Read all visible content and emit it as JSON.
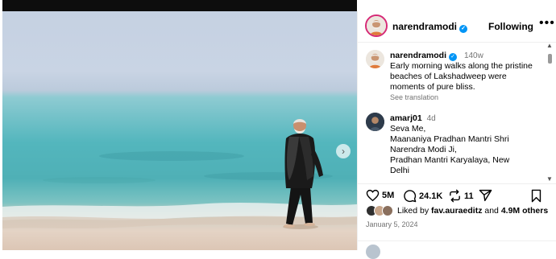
{
  "post": {
    "username": "narendramodi",
    "follow_state": "Following",
    "more_label": "•••",
    "caption": {
      "username": "narendramodi",
      "age": "140w",
      "lines": [
        "Early morning walks along the pristine",
        "beaches of Lakshadweep were",
        "moments of pure bliss."
      ],
      "see_translation": "See translation"
    },
    "comments": [
      {
        "username": "amarj01",
        "age": "4d",
        "lines": [
          "Seva Me,",
          "Maananiya Pradhan Mantri Shri",
          "Narendra Modi Ji,",
          "Pradhan Mantri Karyalaya, New",
          "Delhi"
        ]
      }
    ],
    "actions": {
      "likes_count": "5M",
      "comments_count": "24.1K",
      "reposts_count": "11"
    },
    "liked_by": {
      "prefix": "Liked by",
      "user": "fav.auraeditz",
      "suffix": "and",
      "others": "4.9M others"
    },
    "date": "January 5, 2024",
    "carousel_next": "›",
    "scroll_up": "▲",
    "scroll_down": "▼"
  },
  "colors": {
    "verified": "#0095f6",
    "story_ring": "#d62976",
    "muted_text": "#737373"
  }
}
